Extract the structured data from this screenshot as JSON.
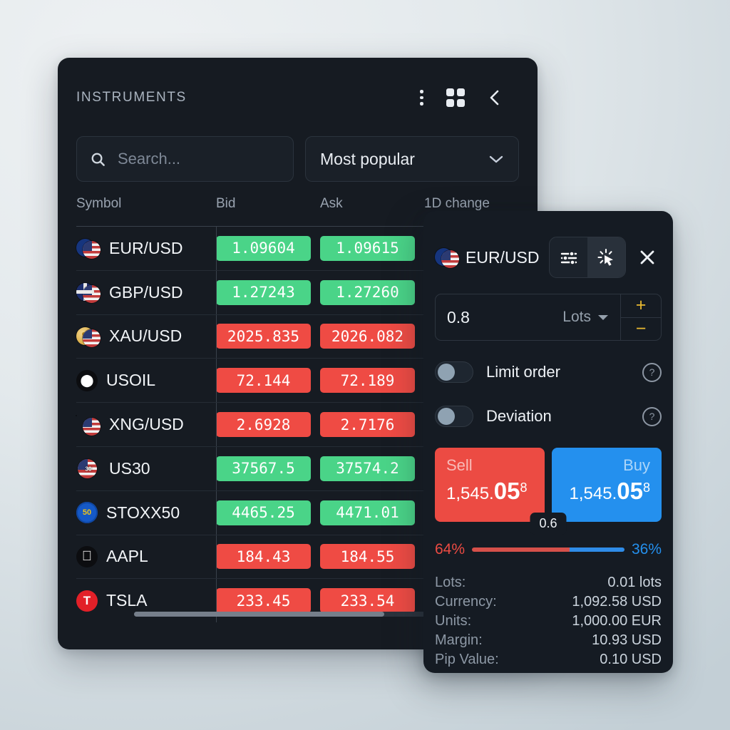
{
  "instruments_panel": {
    "title": "INSTRUMENTS",
    "header_icons": [
      "more-vertical-icon",
      "grid-icon",
      "collapse-left-icon"
    ],
    "search": {
      "placeholder": "Search...",
      "value": "",
      "icon": "search-icon"
    },
    "filter": {
      "selected": "Most popular",
      "icon": "chevron-down-icon"
    },
    "columns": [
      "Symbol",
      "Bid",
      "Ask",
      "1D change"
    ],
    "rows": [
      {
        "symbol": "EUR/USD",
        "bid": "1.09604",
        "ask": "1.09615",
        "dir": "up",
        "icon": "flag-pair-eu-us"
      },
      {
        "symbol": "GBP/USD",
        "bid": "1.27243",
        "ask": "1.27260",
        "dir": "up",
        "icon": "flag-pair-gb-us"
      },
      {
        "symbol": "XAU/USD",
        "bid": "2025.835",
        "ask": "2026.082",
        "dir": "down",
        "icon": "gold-us-icon"
      },
      {
        "symbol": "USOIL",
        "bid": "72.144",
        "ask": "72.189",
        "dir": "down",
        "icon": "oil-drop-icon"
      },
      {
        "symbol": "XNG/USD",
        "bid": "2.6928",
        "ask": "2.7176",
        "dir": "down",
        "icon": "natural-gas-us-icon"
      },
      {
        "symbol": "US30",
        "bid": "37567.5",
        "ask": "37574.2",
        "dir": "up",
        "icon": "us30-flag-icon"
      },
      {
        "symbol": "STOXX50",
        "bid": "4465.25",
        "ask": "4471.01",
        "dir": "up",
        "icon": "stoxx50-icon"
      },
      {
        "symbol": "AAPL",
        "bid": "184.43",
        "ask": "184.55",
        "dir": "down",
        "icon": "apple-icon"
      },
      {
        "symbol": "TSLA",
        "bid": "233.45",
        "ask": "233.54",
        "dir": "down",
        "icon": "tesla-icon"
      }
    ],
    "scrollbar": {
      "thumb_percent": 65
    }
  },
  "trade_panel": {
    "symbol": "EUR/USD",
    "symbol_icon": "flag-pair-eu-us",
    "mode_tabs": [
      {
        "name": "settings-sliders-icon",
        "active": false
      },
      {
        "name": "one-click-trade-icon",
        "active": true
      }
    ],
    "close_icon": "close-icon",
    "quantity": {
      "value": "0.8",
      "unit": "Lots",
      "increase": "+",
      "decrease": "−"
    },
    "toggles": [
      {
        "label": "Limit order",
        "on": false,
        "help": "?"
      },
      {
        "label": "Deviation",
        "on": false,
        "help": "?"
      }
    ],
    "sell": {
      "label": "Sell",
      "price_main": "1,545.",
      "price_big": "05",
      "price_sup": "8"
    },
    "buy": {
      "label": "Buy",
      "price_main": "1,545.",
      "price_big": "05",
      "price_sup": "8"
    },
    "spread": "0.6",
    "sentiment": {
      "sell_percent": "64%",
      "buy_percent": "36%",
      "sell_value": 64,
      "buy_value": 36
    },
    "details": [
      {
        "key": "Lots:",
        "value": "0.01 lots"
      },
      {
        "key": "Currency:",
        "value": "1,092.58 USD"
      },
      {
        "key": "Units:",
        "value": "1,000.00 EUR"
      },
      {
        "key": "Margin:",
        "value": "10.93 USD"
      },
      {
        "key": "Pip Value:",
        "value": "0.10 USD"
      }
    ]
  },
  "colors": {
    "up": "#4ad488",
    "down": "#ef4b44",
    "sell": "#ec4b43",
    "buy": "#2490ee",
    "accent_yellow": "#e9b931",
    "panel_bg": "#161b22"
  }
}
